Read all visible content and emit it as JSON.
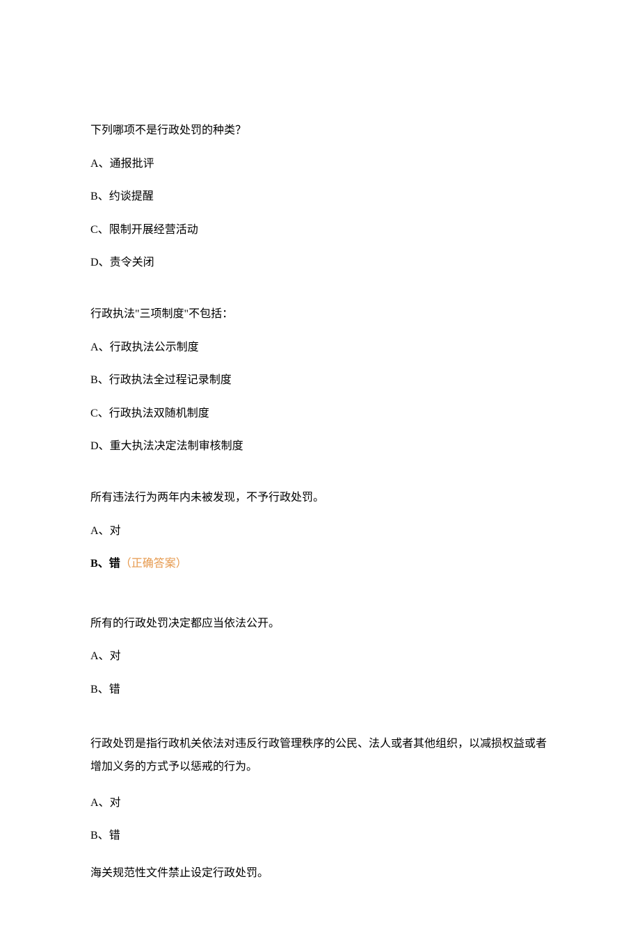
{
  "questions": [
    {
      "text": "下列哪项不是行政处罚的种类？",
      "opts": [
        {
          "label": "A、",
          "text": "通报批评",
          "bold": false,
          "correct": ""
        },
        {
          "label": "B、",
          "text": "约谈提醒",
          "bold": false,
          "correct": ""
        },
        {
          "label": "C、",
          "text": "限制开展经营活动",
          "bold": false,
          "correct": ""
        },
        {
          "label": "D、",
          "text": "责令关闭",
          "bold": false,
          "correct": ""
        }
      ]
    },
    {
      "text": "行政执法\"三项制度\"不包括：",
      "opts": [
        {
          "label": "A、",
          "text": "行政执法公示制度",
          "bold": false,
          "correct": ""
        },
        {
          "label": "B、",
          "text": "行政执法全过程记录制度",
          "bold": false,
          "correct": ""
        },
        {
          "label": "C、",
          "text": "行政执法双随机制度",
          "bold": false,
          "correct": ""
        },
        {
          "label": "D、",
          "text": "重大执法决定法制审核制度",
          "bold": false,
          "correct": ""
        }
      ]
    },
    {
      "text": "所有违法行为两年内未被发现，不予行政处罚。",
      "opts": [
        {
          "label": "A、",
          "text": "对",
          "bold": false,
          "correct": ""
        },
        {
          "label": "B、",
          "text": "错",
          "bold": true,
          "correct": "（正确答案）"
        }
      ]
    },
    {
      "text": "所有的行政处罚决定都应当依法公开。",
      "opts": [
        {
          "label": "A、",
          "text": "对",
          "bold": false,
          "correct": ""
        },
        {
          "label": "B、",
          "text": "错",
          "bold": false,
          "correct": ""
        }
      ]
    },
    {
      "text": "行政处罚是指行政机关依法对违反行政管理秩序的公民、法人或者其他组织，以减损权益或者增加义务的方式予以惩戒的行为。",
      "opts": [
        {
          "label": "A、",
          "text": "对",
          "bold": false,
          "correct": ""
        },
        {
          "label": "B、",
          "text": "错",
          "bold": false,
          "correct": ""
        }
      ]
    },
    {
      "text": "海关规范性文件禁止设定行政处罚。",
      "opts": []
    }
  ]
}
